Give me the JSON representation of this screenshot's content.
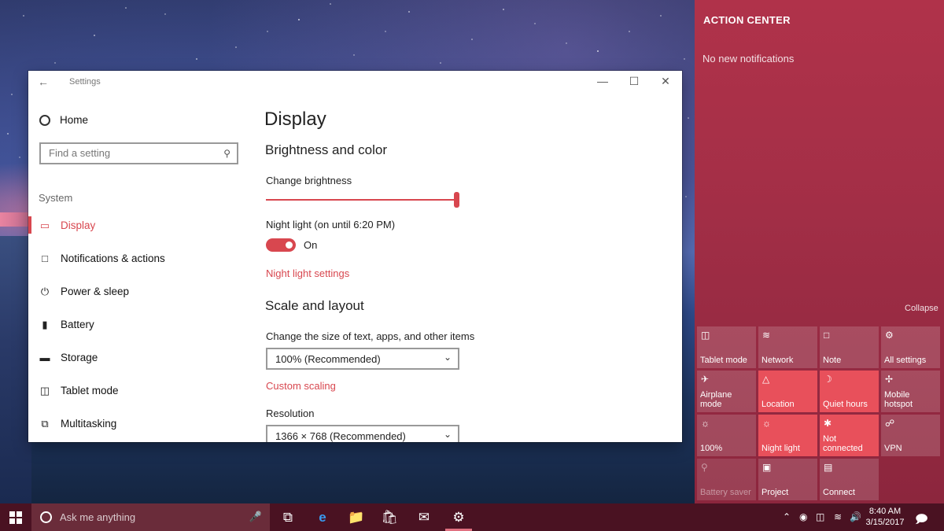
{
  "settings_window": {
    "title": "Settings",
    "nav": {
      "home": "Home",
      "search_placeholder": "Find a setting",
      "section": "System",
      "items": [
        {
          "label": "Display",
          "icon": "monitor-icon",
          "active": true
        },
        {
          "label": "Notifications & actions",
          "icon": "chat-bubble-icon"
        },
        {
          "label": "Power & sleep",
          "icon": "power-icon"
        },
        {
          "label": "Battery",
          "icon": "battery-icon"
        },
        {
          "label": "Storage",
          "icon": "drive-icon"
        },
        {
          "label": "Tablet mode",
          "icon": "tablet-icon"
        },
        {
          "label": "Multitasking",
          "icon": "multitask-icon"
        }
      ]
    },
    "content": {
      "page_title": "Display",
      "brightness_heading": "Brightness and color",
      "brightness_label": "Change brightness",
      "brightness_level": 1.0,
      "night_light_label": "Night light (on until 6:20 PM)",
      "night_light_state": "On",
      "night_light_settings_link": "Night light settings",
      "scale_heading": "Scale and layout",
      "scale_label": "Change the size of text, apps, and other items",
      "scale_value": "100% (Recommended)",
      "custom_scaling_link": "Custom scaling",
      "resolution_label": "Resolution",
      "resolution_value": "1366 × 768 (Recommended)"
    }
  },
  "action_center": {
    "title": "ACTION CENTER",
    "empty_text": "No new notifications",
    "collapse": "Collapse",
    "tiles": [
      {
        "label": "Tablet mode",
        "icon": "tablet-mode-icon",
        "state": "normal"
      },
      {
        "label": "Network",
        "icon": "network-icon",
        "state": "normal"
      },
      {
        "label": "Note",
        "icon": "note-icon",
        "state": "normal"
      },
      {
        "label": "All settings",
        "icon": "gear-icon",
        "state": "normal"
      },
      {
        "label": "Airplane mode",
        "icon": "airplane-icon",
        "state": "normal"
      },
      {
        "label": "Location",
        "icon": "location-icon",
        "state": "on"
      },
      {
        "label": "Quiet hours",
        "icon": "moon-icon",
        "state": "on"
      },
      {
        "label": "Mobile hotspot",
        "icon": "hotspot-icon",
        "state": "normal"
      },
      {
        "label": "100%",
        "icon": "brightness-icon",
        "state": "normal"
      },
      {
        "label": "Night light",
        "icon": "sun-icon",
        "state": "on"
      },
      {
        "label": "Not connected",
        "icon": "bluetooth-icon",
        "state": "on"
      },
      {
        "label": "VPN",
        "icon": "vpn-icon",
        "state": "normal"
      },
      {
        "label": "Battery saver",
        "icon": "battery-saver-icon",
        "state": "off"
      },
      {
        "label": "Project",
        "icon": "project-icon",
        "state": "normal"
      },
      {
        "label": "Connect",
        "icon": "connect-icon",
        "state": "normal"
      }
    ]
  },
  "taskbar": {
    "search_placeholder": "Ask me anything",
    "time": "8:40 AM",
    "date": "3/15/2017"
  },
  "colors": {
    "accent": "#d8474f",
    "action_center_bg": "#a52f47",
    "taskbar_bg": "#4a1222"
  }
}
